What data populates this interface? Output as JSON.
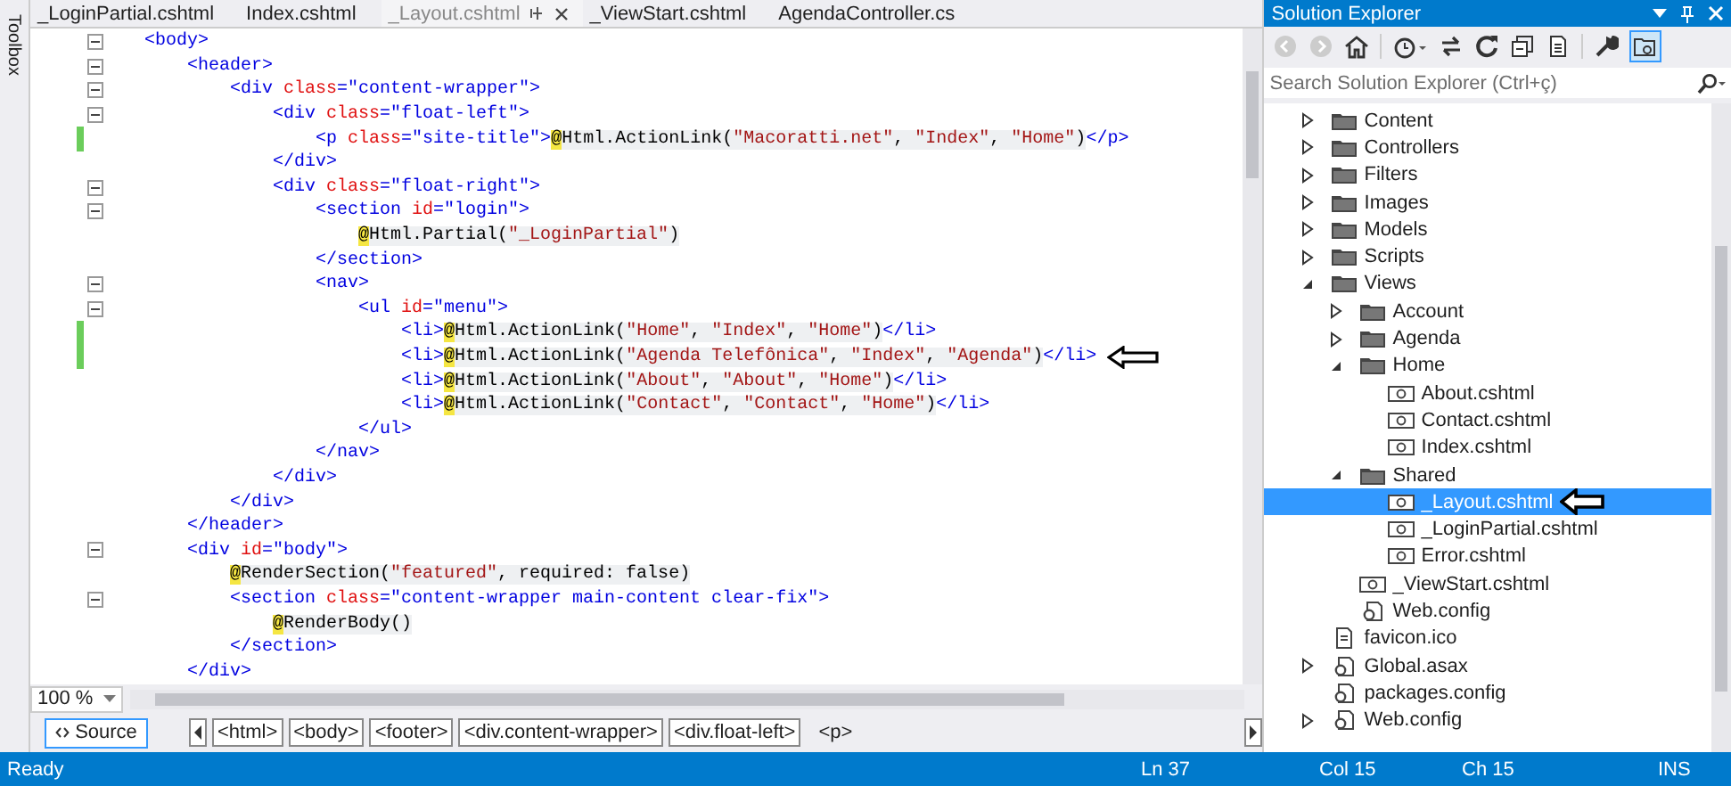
{
  "side_tab": "Toolbox",
  "editor": {
    "tabs": [
      {
        "label": "_LoginPartial.cshtml",
        "selected": false
      },
      {
        "label": "Index.cshtml",
        "selected": false
      },
      {
        "label": "_Layout.cshtml",
        "selected": true
      },
      {
        "label": "_ViewStart.cshtml",
        "selected": false
      },
      {
        "label": "AgendaController.cs",
        "selected": false
      }
    ],
    "lines": [
      {
        "fold": true,
        "changed": false,
        "arrow": false,
        "tokens": [
          {
            "kind": "tag",
            "text": "    <body>"
          }
        ]
      },
      {
        "fold": true,
        "changed": false,
        "arrow": false,
        "tokens": [
          {
            "kind": "tag",
            "text": "        <header>"
          }
        ]
      },
      {
        "fold": true,
        "changed": false,
        "arrow": false,
        "tokens": [
          {
            "kind": "tag",
            "text": "            <div "
          },
          {
            "kind": "attr",
            "text": "class"
          },
          {
            "kind": "tag",
            "text": "=\"content-wrapper\">"
          }
        ]
      },
      {
        "fold": true,
        "changed": false,
        "arrow": false,
        "tokens": [
          {
            "kind": "tag",
            "text": "                <div "
          },
          {
            "kind": "attr",
            "text": "class"
          },
          {
            "kind": "tag",
            "text": "=\"float-left\">"
          }
        ]
      },
      {
        "fold": false,
        "changed": true,
        "arrow": false,
        "tokens": [
          {
            "kind": "tag",
            "text": "                    <p "
          },
          {
            "kind": "attr",
            "text": "class"
          },
          {
            "kind": "tag",
            "text": "=\"site-title\">"
          },
          {
            "kind": "at",
            "text": "@"
          },
          {
            "kind": "code",
            "text": "Html.ActionLink("
          },
          {
            "kind": "str",
            "text": "\"Macoratti.net\""
          },
          {
            "kind": "code",
            "text": ", "
          },
          {
            "kind": "str",
            "text": "\"Index\""
          },
          {
            "kind": "code",
            "text": ", "
          },
          {
            "kind": "str",
            "text": "\"Home\""
          },
          {
            "kind": "code",
            "text": ")"
          },
          {
            "kind": "tag",
            "text": "</p>"
          }
        ]
      },
      {
        "fold": false,
        "changed": false,
        "arrow": false,
        "tokens": [
          {
            "kind": "tag",
            "text": "                </div>"
          }
        ]
      },
      {
        "fold": true,
        "changed": false,
        "arrow": false,
        "tokens": [
          {
            "kind": "tag",
            "text": "                <div "
          },
          {
            "kind": "attr",
            "text": "class"
          },
          {
            "kind": "tag",
            "text": "=\"float-right\">"
          }
        ]
      },
      {
        "fold": true,
        "changed": false,
        "arrow": false,
        "tokens": [
          {
            "kind": "tag",
            "text": "                    <section "
          },
          {
            "kind": "attr",
            "text": "id"
          },
          {
            "kind": "tag",
            "text": "=\"login\">"
          }
        ]
      },
      {
        "fold": false,
        "changed": false,
        "arrow": false,
        "tokens": [
          {
            "kind": "at",
            "text": "                        @"
          },
          {
            "kind": "code",
            "text": "Html.Partial("
          },
          {
            "kind": "str",
            "text": "\"_LoginPartial\""
          },
          {
            "kind": "code",
            "text": ")"
          }
        ]
      },
      {
        "fold": false,
        "changed": false,
        "arrow": false,
        "tokens": [
          {
            "kind": "tag",
            "text": "                    </section>"
          }
        ]
      },
      {
        "fold": true,
        "changed": false,
        "arrow": false,
        "tokens": [
          {
            "kind": "tag",
            "text": "                    <nav>"
          }
        ]
      },
      {
        "fold": true,
        "changed": false,
        "arrow": false,
        "tokens": [
          {
            "kind": "tag",
            "text": "                        <ul "
          },
          {
            "kind": "attr",
            "text": "id"
          },
          {
            "kind": "tag",
            "text": "=\"menu\">"
          }
        ]
      },
      {
        "fold": false,
        "changed": true,
        "arrow": false,
        "tokens": [
          {
            "kind": "tag",
            "text": "                            <li>"
          },
          {
            "kind": "at",
            "text": "@"
          },
          {
            "kind": "code",
            "text": "Html.ActionLink("
          },
          {
            "kind": "str",
            "text": "\"Home\""
          },
          {
            "kind": "code",
            "text": ", "
          },
          {
            "kind": "str",
            "text": "\"Index\""
          },
          {
            "kind": "code",
            "text": ", "
          },
          {
            "kind": "str",
            "text": "\"Home\""
          },
          {
            "kind": "code",
            "text": ")"
          },
          {
            "kind": "tag",
            "text": "</li>"
          }
        ]
      },
      {
        "fold": false,
        "changed": true,
        "arrow": true,
        "tokens": [
          {
            "kind": "tag",
            "text": "                            <li>"
          },
          {
            "kind": "at",
            "text": "@"
          },
          {
            "kind": "code",
            "text": "Html.ActionLink("
          },
          {
            "kind": "str",
            "text": "\"Agenda Telefônica\""
          },
          {
            "kind": "code",
            "text": ", "
          },
          {
            "kind": "str",
            "text": "\"Index\""
          },
          {
            "kind": "code",
            "text": ", "
          },
          {
            "kind": "str",
            "text": "\"Agenda\""
          },
          {
            "kind": "code",
            "text": ")"
          },
          {
            "kind": "tag",
            "text": "</li>"
          }
        ]
      },
      {
        "fold": false,
        "changed": false,
        "arrow": false,
        "tokens": [
          {
            "kind": "tag",
            "text": "                            <li>"
          },
          {
            "kind": "at",
            "text": "@"
          },
          {
            "kind": "code",
            "text": "Html.ActionLink("
          },
          {
            "kind": "str",
            "text": "\"About\""
          },
          {
            "kind": "code",
            "text": ", "
          },
          {
            "kind": "str",
            "text": "\"About\""
          },
          {
            "kind": "code",
            "text": ", "
          },
          {
            "kind": "str",
            "text": "\"Home\""
          },
          {
            "kind": "code",
            "text": ")"
          },
          {
            "kind": "tag",
            "text": "</li>"
          }
        ]
      },
      {
        "fold": false,
        "changed": false,
        "arrow": false,
        "tokens": [
          {
            "kind": "tag",
            "text": "                            <li>"
          },
          {
            "kind": "at",
            "text": "@"
          },
          {
            "kind": "code",
            "text": "Html.ActionLink("
          },
          {
            "kind": "str",
            "text": "\"Contact\""
          },
          {
            "kind": "code",
            "text": ", "
          },
          {
            "kind": "str",
            "text": "\"Contact\""
          },
          {
            "kind": "code",
            "text": ", "
          },
          {
            "kind": "str",
            "text": "\"Home\""
          },
          {
            "kind": "code",
            "text": ")"
          },
          {
            "kind": "tag",
            "text": "</li>"
          }
        ]
      },
      {
        "fold": false,
        "changed": false,
        "arrow": false,
        "tokens": [
          {
            "kind": "tag",
            "text": "                        </ul>"
          }
        ]
      },
      {
        "fold": false,
        "changed": false,
        "arrow": false,
        "tokens": [
          {
            "kind": "tag",
            "text": "                    </nav>"
          }
        ]
      },
      {
        "fold": false,
        "changed": false,
        "arrow": false,
        "tokens": [
          {
            "kind": "tag",
            "text": "                </div>"
          }
        ]
      },
      {
        "fold": false,
        "changed": false,
        "arrow": false,
        "tokens": [
          {
            "kind": "tag",
            "text": "            </div>"
          }
        ]
      },
      {
        "fold": false,
        "changed": false,
        "arrow": false,
        "tokens": [
          {
            "kind": "tag",
            "text": "        </header>"
          }
        ]
      },
      {
        "fold": true,
        "changed": false,
        "arrow": false,
        "tokens": [
          {
            "kind": "tag",
            "text": "        <div "
          },
          {
            "kind": "attr",
            "text": "id"
          },
          {
            "kind": "tag",
            "text": "=\"body\">"
          }
        ]
      },
      {
        "fold": false,
        "changed": false,
        "arrow": false,
        "tokens": [
          {
            "kind": "at",
            "text": "            @"
          },
          {
            "kind": "code",
            "text": "RenderSection("
          },
          {
            "kind": "str",
            "text": "\"featured\""
          },
          {
            "kind": "code",
            "text": ", required: false)"
          }
        ]
      },
      {
        "fold": true,
        "changed": false,
        "arrow": false,
        "tokens": [
          {
            "kind": "tag",
            "text": "            <section "
          },
          {
            "kind": "attr",
            "text": "class"
          },
          {
            "kind": "tag",
            "text": "=\"content-wrapper main-content clear-fix\">"
          }
        ]
      },
      {
        "fold": false,
        "changed": false,
        "arrow": false,
        "tokens": [
          {
            "kind": "at",
            "text": "                @"
          },
          {
            "kind": "code",
            "text": "RenderBody()"
          }
        ]
      },
      {
        "fold": false,
        "changed": false,
        "arrow": false,
        "tokens": [
          {
            "kind": "tag",
            "text": "            </section>"
          }
        ]
      },
      {
        "fold": false,
        "changed": false,
        "arrow": false,
        "tokens": [
          {
            "kind": "tag",
            "text": "        </div>"
          }
        ]
      }
    ],
    "zoom": "100 %",
    "view_button": "Source",
    "breadcrumbs": [
      {
        "label": "<html>",
        "selected": false
      },
      {
        "label": "<body>",
        "selected": false
      },
      {
        "label": "<footer>",
        "selected": false
      },
      {
        "label": "<div.content-wrapper>",
        "selected": false
      },
      {
        "label": "<div.float-left>",
        "selected": false
      },
      {
        "label": "<p>",
        "selected": true
      }
    ]
  },
  "solution_explorer": {
    "title": "Solution Explorer",
    "search": {
      "placeholder": "Search Solution Explorer (Ctrl+ç)"
    },
    "tree": [
      {
        "label": "Content",
        "kind": "folder",
        "expanded": false,
        "selected": false,
        "arrow": false
      },
      {
        "label": "Controllers",
        "kind": "folder",
        "expanded": false,
        "selected": false,
        "arrow": false
      },
      {
        "label": "Filters",
        "kind": "folder",
        "expanded": false,
        "selected": false,
        "arrow": false
      },
      {
        "label": "Images",
        "kind": "folder",
        "expanded": false,
        "selected": false,
        "arrow": false
      },
      {
        "label": "Models",
        "kind": "folder",
        "expanded": false,
        "selected": false,
        "arrow": false
      },
      {
        "label": "Scripts",
        "kind": "folder",
        "expanded": false,
        "selected": false,
        "arrow": false
      },
      {
        "label": "Views",
        "kind": "folder",
        "expanded": true,
        "selected": false,
        "arrow": false,
        "children": [
          {
            "label": "Account",
            "kind": "folder",
            "expanded": false,
            "selected": false,
            "arrow": false
          },
          {
            "label": "Agenda",
            "kind": "folder",
            "expanded": false,
            "selected": false,
            "arrow": false
          },
          {
            "label": "Home",
            "kind": "folder",
            "expanded": true,
            "selected": false,
            "arrow": false,
            "children": [
              {
                "label": "About.cshtml",
                "kind": "razor",
                "selected": false,
                "arrow": false
              },
              {
                "label": "Contact.cshtml",
                "kind": "razor",
                "selected": false,
                "arrow": false
              },
              {
                "label": "Index.cshtml",
                "kind": "razor",
                "selected": false,
                "arrow": false
              }
            ]
          },
          {
            "label": "Shared",
            "kind": "folder",
            "expanded": true,
            "selected": false,
            "arrow": false,
            "children": [
              {
                "label": "_Layout.cshtml",
                "kind": "razor",
                "selected": true,
                "arrow": true
              },
              {
                "label": "_LoginPartial.cshtml",
                "kind": "razor",
                "selected": false,
                "arrow": false
              },
              {
                "label": "Error.cshtml",
                "kind": "razor",
                "selected": false,
                "arrow": false
              }
            ]
          },
          {
            "label": "_ViewStart.cshtml",
            "kind": "razor",
            "selected": false,
            "arrow": false
          },
          {
            "label": "Web.config",
            "kind": "config",
            "selected": false,
            "arrow": false
          }
        ]
      },
      {
        "label": "favicon.ico",
        "kind": "file",
        "selected": false,
        "arrow": false
      },
      {
        "label": "Global.asax",
        "kind": "config",
        "expanded": false,
        "selected": false,
        "arrow": false
      },
      {
        "label": "packages.config",
        "kind": "config",
        "selected": false,
        "arrow": false
      },
      {
        "label": "Web.config",
        "kind": "config",
        "expanded": false,
        "selected": false,
        "arrow": false
      }
    ]
  },
  "status_bar": {
    "state": "Ready",
    "line": "Ln 37",
    "column": "Col 15",
    "char": "Ch 15",
    "mode": "INS"
  }
}
